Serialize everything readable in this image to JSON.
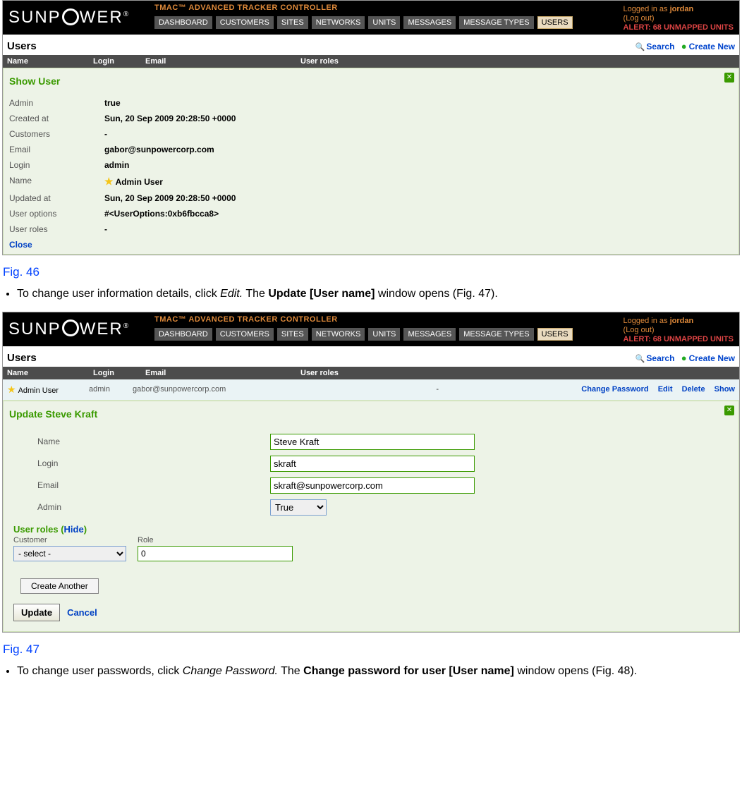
{
  "brand": "SUNPOWER",
  "app_title": "TMAC™ ADVANCED TRACKER CONTROLLER",
  "status": {
    "logged_in_prefix": "Logged in as ",
    "user": "jordan",
    "logout": "(Log out)",
    "alert": "ALERT: 68 UNMAPPED UNITS"
  },
  "tabs": [
    "DASHBOARD",
    "CUSTOMERS",
    "SITES",
    "NETWORKS",
    "UNITS",
    "MESSAGES",
    "MESSAGE TYPES",
    "USERS"
  ],
  "section": {
    "title": "Users",
    "search": "Search",
    "create": "Create New"
  },
  "columns": {
    "name": "Name",
    "login": "Login",
    "email": "Email",
    "roles": "User roles"
  },
  "show_panel": {
    "title": "Show User",
    "close": "Close",
    "fields": {
      "admin_k": "Admin",
      "admin_v": "true",
      "created_k": "Created at",
      "created_v": "Sun, 20 Sep 2009 20:28:50 +0000",
      "customers_k": "Customers",
      "customers_v": "-",
      "email_k": "Email",
      "email_v": "gabor@sunpowercorp.com",
      "login_k": "Login",
      "login_v": "admin",
      "name_k": "Name",
      "name_v": "Admin User",
      "updated_k": "Updated at",
      "updated_v": "Sun, 20 Sep 2009 20:28:50 +0000",
      "options_k": "User options",
      "options_v": "#<UserOptions:0xb6fbcca8>",
      "roles_k": "User roles",
      "roles_v": "-"
    }
  },
  "fig46": "Fig. 46",
  "bullet1_a": "To change user information details, click ",
  "bullet1_i": "Edit.",
  "bullet1_b": " The ",
  "bullet1_bold": "Update [User name]",
  "bullet1_c": " window opens (Fig. 47).",
  "row": {
    "name": "Admin User",
    "login": "admin",
    "email": "gabor@sunpowercorp.com",
    "roles": "-",
    "act_changepw": "Change Password",
    "act_edit": "Edit",
    "act_delete": "Delete",
    "act_show": "Show"
  },
  "update_panel": {
    "title": "Update Steve Kraft",
    "labels": {
      "name": "Name",
      "login": "Login",
      "email": "Email",
      "admin": "Admin"
    },
    "values": {
      "name": "Steve Kraft",
      "login": "skraft",
      "email": "skraft@sunpowercorp.com",
      "admin": "True"
    },
    "roles_title_a": "User roles (",
    "roles_hide": "Hide",
    "roles_title_b": ")",
    "roles": {
      "customer_label": "Customer",
      "customer_value": "- select -",
      "role_label": "Role",
      "role_value": "0"
    },
    "create_another": "Create Another",
    "update": "Update",
    "cancel": "Cancel"
  },
  "fig47": "Fig. 47",
  "bullet2_a": "To change user passwords, click ",
  "bullet2_i": "Change Password.",
  "bullet2_b": " The ",
  "bullet2_bold": "Change password for user [User name]",
  "bullet2_c": " window opens (Fig. 48)."
}
